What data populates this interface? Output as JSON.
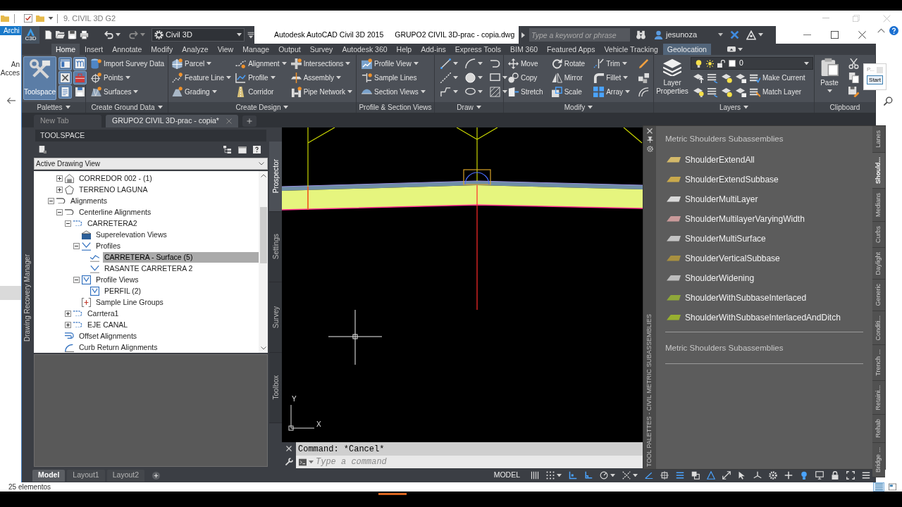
{
  "explorer": {
    "title": "9. CIVIL 3D G2",
    "ribbon_tab": "Archi",
    "nav_labels": [
      "An",
      "Acces"
    ],
    "popup": {
      "label": "P...",
      "button": "Start"
    },
    "status": "25 elementos"
  },
  "title_bar": {
    "badge": "C3D",
    "workspace": "Civil 3D",
    "app": "Autodesk AutoCAD Civil 3D 2015",
    "file": "GRUPO2 CIVIL 3D-prac - copia.dwg",
    "search": {
      "placeholder": "Type a keyword or phrase"
    },
    "user": "jesunoza"
  },
  "ribbon": {
    "tabs": [
      {
        "label": "Home",
        "selected": true,
        "contextual": false
      },
      {
        "label": "Insert",
        "selected": false,
        "contextual": false
      },
      {
        "label": "Annotate",
        "selected": false,
        "contextual": false
      },
      {
        "label": "Modify",
        "selected": false,
        "contextual": false
      },
      {
        "label": "Analyze",
        "selected": false,
        "contextual": false
      },
      {
        "label": "View",
        "selected": false,
        "contextual": false
      },
      {
        "label": "Manage",
        "selected": false,
        "contextual": false
      },
      {
        "label": "Output",
        "selected": false,
        "contextual": false
      },
      {
        "label": "Survey",
        "selected": false,
        "contextual": false
      },
      {
        "label": "Autodesk 360",
        "selected": false,
        "contextual": false
      },
      {
        "label": "Help",
        "selected": false,
        "contextual": false
      },
      {
        "label": "Add-ins",
        "selected": false,
        "contextual": false
      },
      {
        "label": "Express Tools",
        "selected": false,
        "contextual": false
      },
      {
        "label": "BIM 360",
        "selected": false,
        "contextual": false
      },
      {
        "label": "Featured Apps",
        "selected": false,
        "contextual": false
      },
      {
        "label": "Vehicle Tracking",
        "selected": false,
        "contextual": false
      },
      {
        "label": "Geolocation",
        "selected": false,
        "contextual": true
      }
    ],
    "panels": [
      {
        "kind": "palettes",
        "title": "Palettes",
        "menu": true,
        "big": {
          "kind": "toolspace",
          "label": "Toolspace",
          "on": true
        },
        "columns": [
          [
            {
              "kind": "prospector",
              "on": true
            },
            {
              "kind": "survey_tools",
              "on": true
            },
            {
              "kind": "doc_panel",
              "on": true
            }
          ],
          [
            {
              "kind": "props_table",
              "on": true
            },
            {
              "kind": "toolbox",
              "on": true
            },
            {
              "kind": "save_panel",
              "on": false
            }
          ]
        ]
      },
      {
        "kind": "columns",
        "title": "Create Ground Data",
        "menu": true,
        "columns": [
          [
            {
              "kind": "survey",
              "label": "Import Survey Data",
              "menu": false
            },
            {
              "kind": "points",
              "label": "Points",
              "menu": true
            },
            {
              "kind": "surfaces",
              "label": "Surfaces",
              "menu": true
            }
          ]
        ]
      },
      {
        "kind": "columns",
        "title": "Create Design",
        "menu": true,
        "columns": [
          [
            {
              "kind": "parcel",
              "label": "Parcel",
              "menu": true
            },
            {
              "kind": "feature_line",
              "label": "Feature Line",
              "menu": true
            },
            {
              "kind": "grading",
              "label": "Grading",
              "menu": true
            }
          ],
          [
            {
              "kind": "alignment",
              "label": "Alignment",
              "menu": true
            },
            {
              "kind": "profile",
              "label": "Profile",
              "menu": true
            },
            {
              "kind": "corridor",
              "label": "Corridor",
              "menu": false
            }
          ],
          [
            {
              "kind": "intersections",
              "label": "Intersections",
              "menu": true
            },
            {
              "kind": "assembly",
              "label": "Assembly",
              "menu": true
            },
            {
              "kind": "pipe_network",
              "label": "Pipe Network",
              "menu": true
            }
          ]
        ]
      },
      {
        "kind": "columns",
        "title": "Profile & Section Views",
        "menu": false,
        "columns": [
          [
            {
              "kind": "profile_view",
              "label": "Profile View",
              "menu": true
            },
            {
              "kind": "sample_lines",
              "label": "Sample Lines",
              "menu": false
            },
            {
              "kind": "section_views",
              "label": "Section Views",
              "menu": true
            }
          ]
        ]
      },
      {
        "kind": "columns",
        "title": "Draw",
        "menu": true,
        "columns": [
          [
            {
              "kind": "line",
              "menu": true
            },
            {
              "kind": "construction_line",
              "menu": true
            },
            {
              "kind": "polyline",
              "menu": true
            }
          ],
          [
            {
              "kind": "arc",
              "menu": true
            },
            {
              "kind": "circle",
              "menu": true
            },
            {
              "kind": "ellipse",
              "menu": true
            }
          ],
          [
            {
              "kind": "revision_cloud",
              "menu": false
            },
            {
              "kind": "rectangle",
              "menu": true
            },
            {
              "kind": "hatch",
              "menu": true
            }
          ]
        ]
      },
      {
        "kind": "columns",
        "title": "Modify",
        "menu": true,
        "columns": [
          [
            {
              "kind": "move",
              "label": "Move",
              "menu": false
            },
            {
              "kind": "copy",
              "label": "Copy",
              "menu": false
            },
            {
              "kind": "stretch",
              "label": "Stretch",
              "menu": false
            }
          ],
          [
            {
              "kind": "rotate",
              "label": "Rotate",
              "menu": false
            },
            {
              "kind": "mirror",
              "label": "Mirror",
              "menu": false
            },
            {
              "kind": "scale",
              "label": "Scale",
              "menu": false
            }
          ],
          [
            {
              "kind": "trim",
              "label": "Trim",
              "menu": true
            },
            {
              "kind": "fillet",
              "label": "Fillet",
              "menu": true
            },
            {
              "kind": "array",
              "label": "Array",
              "menu": true
            }
          ],
          [
            {
              "kind": "erase",
              "menu": false
            },
            {
              "kind": "explode",
              "menu": false
            },
            {
              "kind": "offset",
              "menu": false
            }
          ]
        ]
      },
      {
        "kind": "layers",
        "title": "Layers",
        "menu": true,
        "big": {
          "kind": "layer_properties",
          "label": "Layer Properties"
        },
        "layer": {
          "value": "0"
        },
        "rows": [
          [
            {
              "kind": "layer_pin"
            },
            {
              "kind": "layer_stack"
            },
            {
              "kind": "layer_star"
            },
            {
              "kind": "layer_lock"
            },
            {
              "kind": "make_current",
              "label": "Make Current"
            }
          ],
          [
            {
              "kind": "layer_bulb"
            },
            {
              "kind": "layer_stack"
            },
            {
              "kind": "layer_star"
            },
            {
              "kind": "layer_lock"
            },
            {
              "kind": "match_layer",
              "label": "Match Layer"
            }
          ]
        ]
      },
      {
        "kind": "clipboard",
        "title": "Clipboard",
        "menu": false,
        "big": {
          "kind": "paste",
          "label": "Paste",
          "menu": true
        },
        "columns": [
          [
            {
              "kind": "cut"
            },
            {
              "kind": "copy_clipboard"
            },
            {
              "kind": "match_properties"
            }
          ]
        ]
      }
    ]
  },
  "file_tabs": [
    {
      "label": "New Tab",
      "selected": false
    },
    {
      "label": "GRUPO2 CIVIL 3D-prac - copia*",
      "selected": true
    }
  ],
  "recovery_manager": {
    "label": "Drawing Recovery Manager"
  },
  "toolspace": {
    "title": "TOOLSPACE",
    "view": {
      "value": "Active Drawing View"
    },
    "tree": [
      {
        "children": [
          {
            "kind": "corridor",
            "label": "CORREDOR 002 - (1)",
            "expanded": false,
            "selected": false
          },
          {
            "kind": "surface",
            "label": "TERRENO LAGUNA",
            "expanded": false,
            "selected": false
          }
        ]
      },
      {
        "kind": "alignments",
        "label": "Alignments",
        "expanded": true,
        "selected": false,
        "children": [
          {
            "kind": "alignments",
            "label": "Centerline Alignments",
            "expanded": true,
            "selected": false,
            "children": [
              {
                "kind": "alignment",
                "label": "CARRETERA2",
                "expanded": true,
                "selected": false,
                "children": [
                  {
                    "kind": "superelevation",
                    "label": "Superelevation Views",
                    "selected": false
                  },
                  {
                    "kind": "profiles",
                    "label": "Profiles",
                    "expanded": true,
                    "selected": false,
                    "children": [
                      {
                        "kind": "profile",
                        "label": "CARRETERA - Surface (5)",
                        "selected": true
                      },
                      {
                        "kind": "profile_design",
                        "label": "RASANTE CARRETERA 2",
                        "selected": false
                      }
                    ]
                  },
                  {
                    "kind": "profile_views",
                    "label": "Profile Views",
                    "expanded": true,
                    "selected": false,
                    "children": [
                      {
                        "kind": "profile_views",
                        "label": "PERFIL (2)",
                        "selected": false
                      }
                    ]
                  },
                  {
                    "kind": "sample_line_groups",
                    "label": "Sample Line Groups",
                    "selected": false
                  }
                ]
              },
              {
                "kind": "alignment",
                "label": "Carrtera1",
                "expanded": false,
                "selected": false
              },
              {
                "kind": "alignment",
                "label": "EJE CANAL",
                "expanded": false,
                "selected": false
              }
            ]
          },
          {
            "kind": "offset_alignments",
            "label": "Offset Alignments",
            "selected": false
          },
          {
            "kind": "curb_returns",
            "label": "Curb Return Alignments",
            "selected": false
          }
        ]
      }
    ],
    "tabs": [
      {
        "label": "Prospector",
        "selected": true
      },
      {
        "label": "Settings",
        "selected": false
      },
      {
        "label": "Survey",
        "selected": false
      },
      {
        "label": "Toolbox",
        "selected": false
      }
    ]
  },
  "drawing": {
    "ucs": {
      "y_label": "Y",
      "x_label": "X"
    }
  },
  "command_line": {
    "history": "Command: *Cancel*",
    "input": {
      "placeholder": "Type a command"
    }
  },
  "layout_tabs": [
    {
      "label": "Model",
      "selected": true
    },
    {
      "label": "Layout1",
      "selected": false
    },
    {
      "label": "Layout2",
      "selected": false
    }
  ],
  "status_bar": {
    "space": "MODEL",
    "toggles": [
      {
        "kind": "grid",
        "on": false,
        "menu": false
      },
      {
        "kind": "snap",
        "on": false,
        "menu": true
      },
      {
        "kind": "infer_constraints",
        "on": true,
        "menu": false
      },
      {
        "kind": "ortho",
        "on": true,
        "menu": false
      },
      {
        "kind": "polar",
        "on": false,
        "menu": true
      },
      {
        "kind": "isometric",
        "on": false,
        "menu": true
      },
      {
        "kind": "object_tracking",
        "on": true,
        "menu": false
      },
      {
        "kind": "object_snap",
        "on": false,
        "menu": false
      },
      {
        "kind": "lineweight",
        "on": true,
        "menu": false
      },
      {
        "kind": "transparency",
        "on": false,
        "menu": false
      },
      {
        "kind": "annotation",
        "on": true,
        "menu": false
      },
      {
        "kind": "auto_scale",
        "on": false,
        "menu": false
      },
      {
        "kind": "selection",
        "on": false,
        "menu": false
      },
      {
        "kind": "axes",
        "on": false,
        "menu": false
      },
      {
        "kind": "gear",
        "on": false,
        "menu": false
      },
      {
        "kind": "plus",
        "on": false,
        "menu": false
      },
      {
        "kind": "isolate",
        "on": true,
        "menu": false
      },
      {
        "kind": "hardware",
        "on": false,
        "menu": false
      },
      {
        "kind": "lock",
        "on": false,
        "menu": false
      },
      {
        "kind": "clean_screen",
        "on": false,
        "menu": false
      },
      {
        "kind": "menu",
        "on": false,
        "menu": false
      }
    ]
  },
  "tool_palette": {
    "title": "TOOL PALETTES - CIVIL METRIC SUBASSEMBLIES",
    "sections": [
      {
        "heading": "Metric Shoulders Subassemblies",
        "items": [
          {
            "label": "ShoulderExtendAll",
            "color": "#d4b96a"
          },
          {
            "label": "ShoulderExtendSubbase",
            "color": "#c9a94c"
          },
          {
            "label": "ShoulderMultiLayer",
            "color": "#d8d8d8"
          },
          {
            "label": "ShoulderMultilayerVaryingWidth",
            "color": "#c99a9a"
          },
          {
            "label": "ShoulderMultiSurface",
            "color": "#c4c4c4"
          },
          {
            "label": "ShoulderVerticalSubbase",
            "color": "#a89040"
          },
          {
            "label": "ShoulderWidening",
            "color": "#bdbdbd"
          },
          {
            "label": "ShoulderWithSubbaseInterlaced",
            "color": "#8fa83a"
          },
          {
            "label": "ShoulderWithSubbaseInterlacedAndDitch",
            "color": "#98b030"
          }
        ]
      },
      {
        "heading": "Metric Shoulders Subassemblies"
      }
    ],
    "tabs": [
      {
        "label": "Lanes",
        "selected": false
      },
      {
        "label": "Should...",
        "selected": true
      },
      {
        "label": "Medians",
        "selected": false
      },
      {
        "label": "Curbs",
        "selected": false
      },
      {
        "label": "Daylight",
        "selected": false
      },
      {
        "label": "Generic",
        "selected": false
      },
      {
        "label": "Conditi...",
        "selected": false
      },
      {
        "label": "Trench ...",
        "selected": false
      },
      {
        "label": "Retaini...",
        "selected": false
      },
      {
        "label": "Rehab",
        "selected": false
      },
      {
        "label": "Bridge ...",
        "selected": false
      }
    ]
  }
}
